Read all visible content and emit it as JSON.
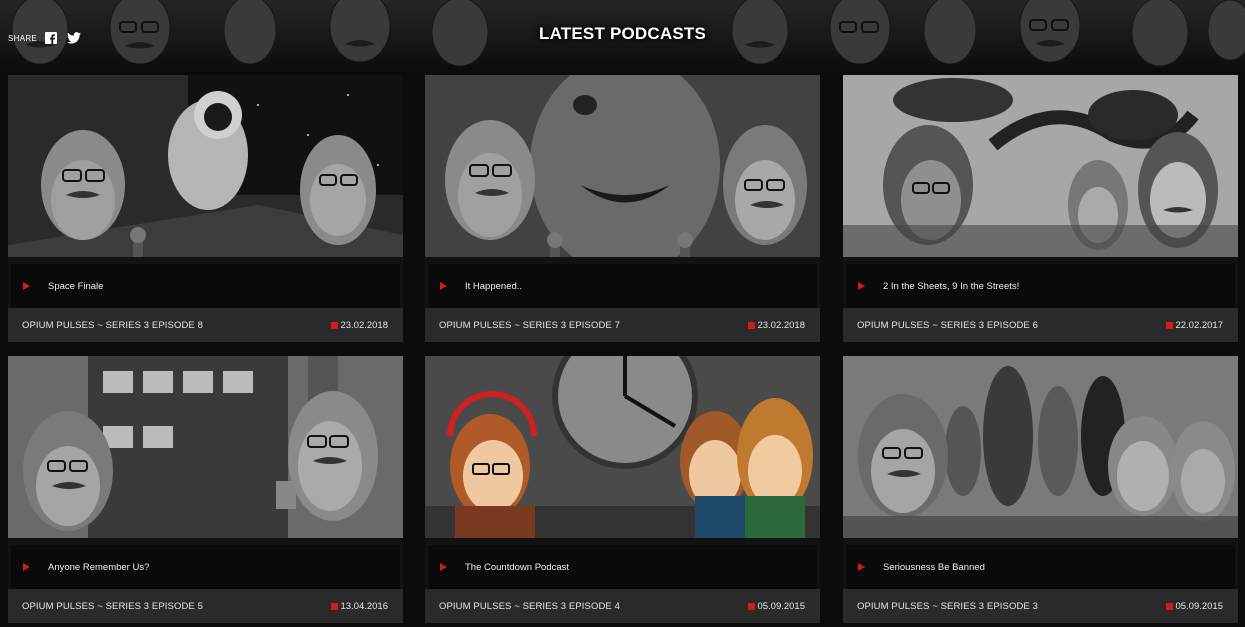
{
  "header": {
    "title": "LATEST PODCASTS",
    "share_label": "SHARE",
    "social": [
      {
        "icon": "facebook-icon"
      },
      {
        "icon": "twitter-icon"
      }
    ]
  },
  "podcasts": [
    {
      "title": "Space Finale",
      "series": "OPIUM PULSES ~ SERIES 3 EPISODE 8",
      "date": "23.02.2018",
      "thumb": "astronaut"
    },
    {
      "title": "It Happened..",
      "series": "OPIUM PULSES ~ SERIES 3 EPISODE 7",
      "date": "23.02.2018",
      "thumb": "dinosaur"
    },
    {
      "title": "2 In the Sheets, 9 In the Streets!",
      "series": "OPIUM PULSES ~ SERIES 3 EPISODE 6",
      "date": "22.02.2017",
      "thumb": "snake"
    },
    {
      "title": "Anyone Remember Us?",
      "series": "OPIUM PULSES ~ SERIES 3 EPISODE 5",
      "date": "13.04.2016",
      "thumb": "bus"
    },
    {
      "title": "The Countdown Podcast",
      "series": "OPIUM PULSES ~ SERIES 3 EPISODE 4",
      "date": "05.09.2015",
      "thumb": "clock"
    },
    {
      "title": "Seriousness Be Banned",
      "series": "OPIUM PULSES ~ SERIES 3 EPISODE 3",
      "date": "05.09.2015",
      "thumb": "heroes"
    }
  ],
  "colors": {
    "accent": "#d21c1c",
    "background": "#0c0c0c",
    "meta_bar": "#2a2a2a",
    "title_bar": "#0a0a0a"
  }
}
